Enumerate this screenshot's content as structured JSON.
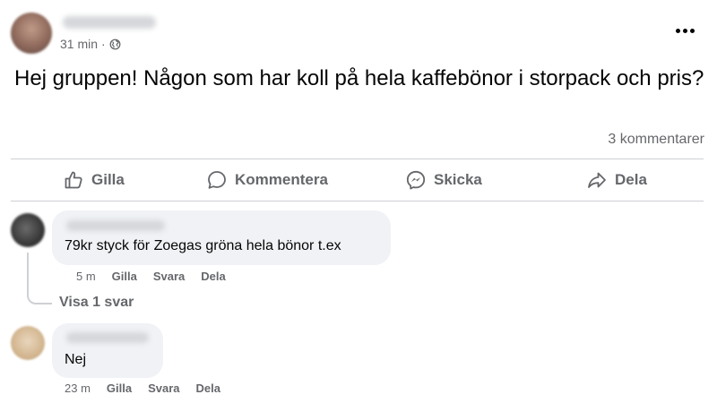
{
  "post": {
    "time": "31 min",
    "separator": "·",
    "privacy_icon": "globe-icon",
    "more_icon": "more-dots-icon",
    "text": "Hej gruppen! Någon som har koll på hela kaffebönor i storpack och pris?",
    "comment_count": "3 kommentarer"
  },
  "actions": {
    "like": {
      "label": "Gilla",
      "icon": "thumbs-up-icon"
    },
    "comment": {
      "label": "Kommentera",
      "icon": "speech-bubble-icon"
    },
    "send": {
      "label": "Skicka",
      "icon": "messenger-icon"
    },
    "share": {
      "label": "Dela",
      "icon": "share-arrow-icon"
    }
  },
  "comments": [
    {
      "text": "79kr styck för Zoegas gröna hela bönor t.ex",
      "time": "5 m",
      "like": "Gilla",
      "reply": "Svara",
      "share": "Dela",
      "view_replies": "Visa 1 svar"
    },
    {
      "text": "Nej",
      "time": "23 m",
      "like": "Gilla",
      "reply": "Svara",
      "share": "Dela"
    }
  ],
  "colors": {
    "text_primary": "#050505",
    "text_secondary": "#65676b",
    "bubble_bg": "#f0f2f5",
    "divider": "#ced0d4"
  }
}
